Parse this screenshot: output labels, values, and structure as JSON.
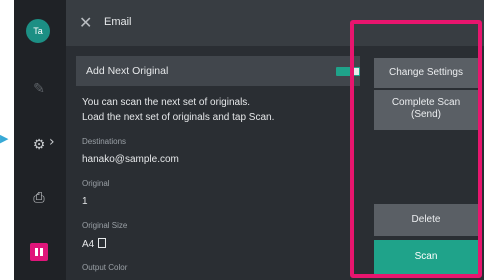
{
  "callout": {
    "arrow_icon": "arrow-right-icon"
  },
  "rail": {
    "user_initials": "Ta",
    "icons": [
      "pencil-off-icon",
      "settings-gear-icon",
      "printer-job-icon",
      "pause-icon"
    ]
  },
  "header": {
    "title": "Email"
  },
  "main": {
    "add_next_original": {
      "label": "Add Next Original",
      "enabled": true
    },
    "message_line1": "You can scan the next set of originals.",
    "message_line2": "Load the next set of originals and tap Scan.",
    "fields": [
      {
        "label": "Destinations",
        "value": "hanako@sample.com"
      },
      {
        "label": "Original",
        "value": "1"
      },
      {
        "label": "Original Size",
        "value": "A4"
      },
      {
        "label": "Output Color",
        "value": ""
      }
    ]
  },
  "actions": {
    "change_settings": "Change Settings",
    "complete_scan_line1": "Complete Scan",
    "complete_scan_line2": "(Send)",
    "delete": "Delete",
    "scan": "Scan"
  },
  "colors": {
    "accent": "#1fa38a",
    "highlight": "#e8156e",
    "stop": "#e0157a",
    "avatar": "#1c8f84"
  }
}
